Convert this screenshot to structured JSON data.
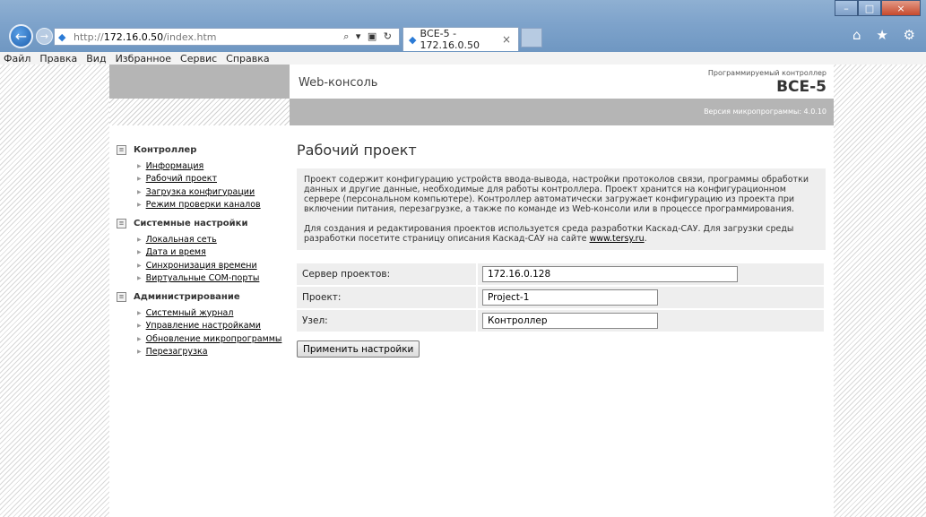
{
  "browser": {
    "url_prefix": "http://",
    "url_host": "172.16.0.50",
    "url_path": "/index.htm",
    "addr_tools": "⌕ ▾ ▣ ↻",
    "tab_title": "ВСЕ-5 - 172.16.0.50",
    "tab_close": "×",
    "minimize": "–",
    "maximize": "□",
    "close": "×",
    "right_icons": "⌂ ★ ⚙"
  },
  "menu": [
    "Файл",
    "Правка",
    "Вид",
    "Избранное",
    "Сервис",
    "Справка"
  ],
  "header": {
    "console_title": "Web-консоль",
    "controller_subtitle": "Программируемый контроллер",
    "controller_model": "ВСЕ-5",
    "firmware_version": "Версия микропрограммы: 4.0.10"
  },
  "sidebar": {
    "sections": [
      {
        "title": "Контроллер",
        "items": [
          "Информация",
          "Рабочий проект",
          "Загрузка конфигурации",
          "Режим проверки каналов"
        ]
      },
      {
        "title": "Системные настройки",
        "items": [
          "Локальная сеть",
          "Дата и время",
          "Синхронизация времени",
          "Виртуальные COM-порты"
        ]
      },
      {
        "title": "Администрирование",
        "items": [
          "Системный журнал",
          "Управление настройками",
          "Обновление микропрограммы",
          "Перезагрузка"
        ]
      }
    ]
  },
  "main": {
    "title": "Рабочий проект",
    "desc_p1": "Проект содержит конфигурацию устройств ввода-вывода, настройки протоколов связи, программы обработки данных и другие данные, необходимые для работы контроллера. Проект хранится на конфигурационном сервере (персональном компьютере). Контроллер автоматически загружает конфигурацию из проекта при включении питания, перезагрузке, а также по команде из Web-консоли или в процессе программирования.",
    "desc_p2_before": "Для создания и редактирования проектов используется среда разработки Каскад-САУ. Для загрузки среды разработки посетите страницу описания Каскад-САУ на сайте ",
    "desc_p2_link": "www.tersy.ru",
    "desc_p2_after": ".",
    "fields": {
      "server_label": "Сервер проектов:",
      "server_value": "172.16.0.128",
      "project_label": "Проект:",
      "project_value": "Project-1",
      "node_label": "Узел:",
      "node_value": "Контроллер"
    },
    "apply_button": "Применить настройки"
  }
}
